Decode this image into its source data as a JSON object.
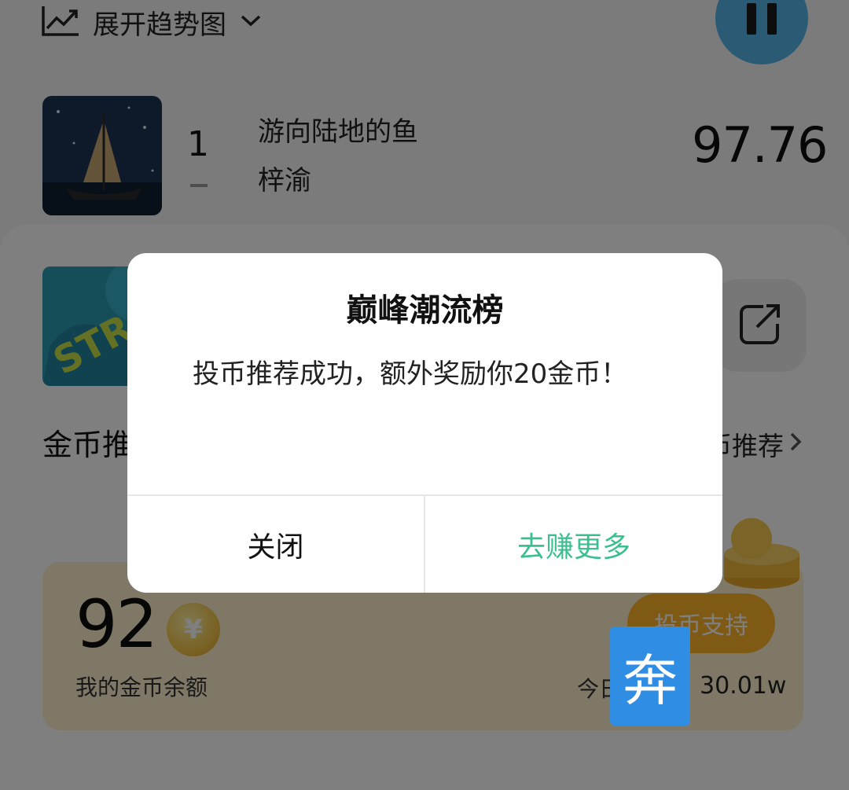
{
  "trend": {
    "label": "展开趋势图"
  },
  "song1": {
    "rank": "1",
    "title": "游向陆地的鱼",
    "artist": "梓渝",
    "score": "97.76"
  },
  "section": {
    "title": "金币推",
    "more": "币推荐"
  },
  "coin_card": {
    "balance": "92",
    "coin_symbol": "¥",
    "balance_label": "我的金币余额",
    "vote_button": "投币支持",
    "today_label": "今日",
    "today_value": "30.01w"
  },
  "dialog": {
    "title": "巅峰潮流榜",
    "message": "投币推荐成功，额外奖励你20金币！",
    "close_button": "关闭",
    "more_button": "去赚更多"
  },
  "float_badge": {
    "text": "奔"
  },
  "colors": {
    "overlay": "rgba(0,0,0,0.5)",
    "accent_green": "#3cbf8f",
    "coin_button": "#ffb429",
    "badge_blue": "#2f8de4"
  },
  "icons": [
    "trend-icon",
    "chevron-down-icon",
    "pause-icon",
    "share-icon",
    "chevron-right-icon",
    "coin-icon"
  ]
}
